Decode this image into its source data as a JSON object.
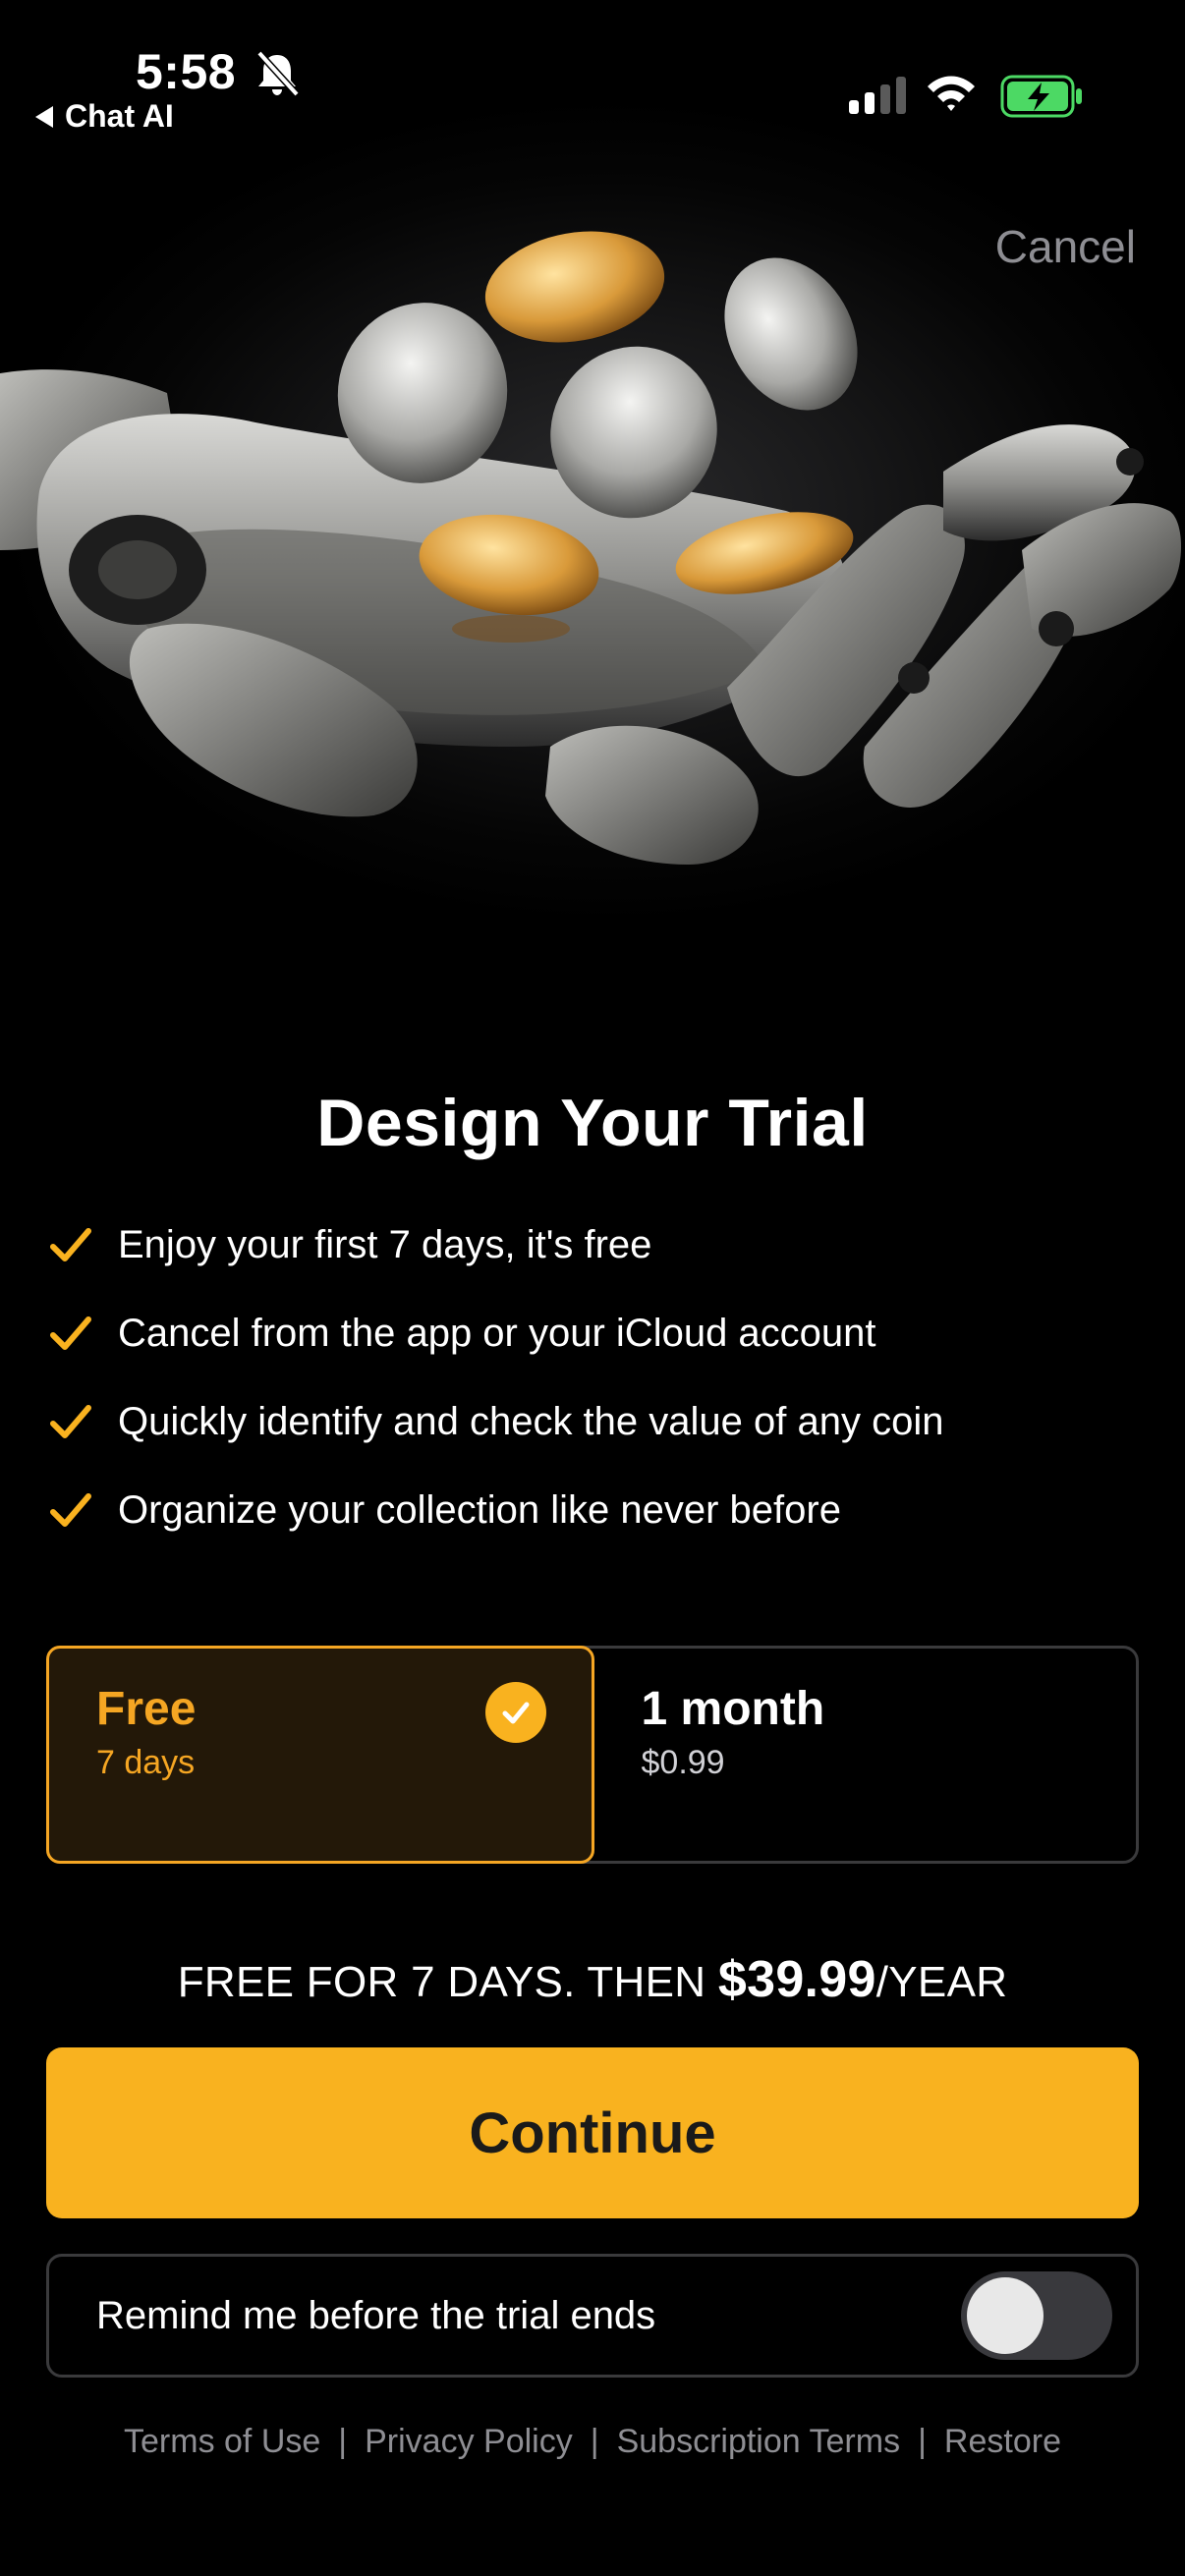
{
  "status_bar": {
    "time": "5:58",
    "back_app": "Chat AI",
    "icons": [
      "bell-slash-icon",
      "cellular-signal-icon",
      "wifi-icon",
      "battery-charging-icon"
    ]
  },
  "header": {
    "cancel_label": "Cancel",
    "hero_image": "robot-hand-holding-coins"
  },
  "title": "Design Your Trial",
  "features": [
    "Enjoy your first 7 days, it's free",
    "Cancel from the app or your iCloud account",
    "Quickly identify and check the value of any coin",
    "Organize your collection like never before"
  ],
  "plans": [
    {
      "name": "Free",
      "sub": "7 days",
      "selected": true
    },
    {
      "name": "1 month",
      "sub": "$0.99",
      "selected": false
    }
  ],
  "price_line": {
    "prefix": "FREE FOR 7 DAYS. THEN ",
    "price": "$39.99",
    "suffix": "/YEAR"
  },
  "continue_label": "Continue",
  "remind": {
    "label": "Remind me before the trial ends",
    "enabled": false
  },
  "footer_links": [
    "Terms of Use",
    "Privacy Policy",
    "Subscription Terms",
    "Restore"
  ],
  "colors": {
    "accent": "#F9B21F",
    "background": "#000000",
    "selected_plan_bg": "#231808",
    "muted_text": "#8E8E93",
    "border": "#3A3A3C"
  }
}
